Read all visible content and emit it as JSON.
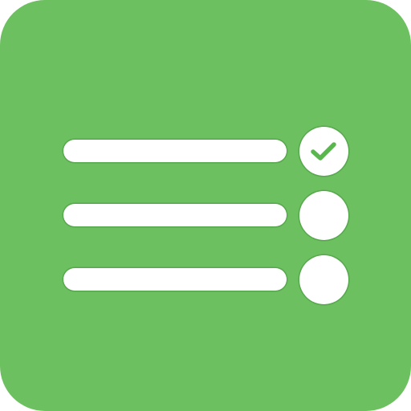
{
  "icon": {
    "name": "checklist-app-icon",
    "background_color": "#6cc05f",
    "foreground_color": "#ffffff",
    "accent_color": "#5cb650"
  },
  "items": [
    {
      "checked": true
    },
    {
      "checked": false
    },
    {
      "checked": false
    }
  ]
}
